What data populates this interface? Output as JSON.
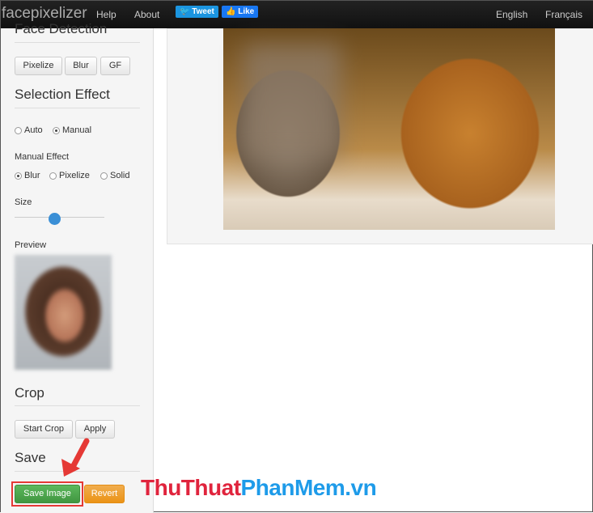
{
  "header": {
    "brand": "facepixelizer",
    "nav": [
      "Help",
      "About"
    ],
    "tweet": "Tweet",
    "like": "Like",
    "lang": [
      "English",
      "Français"
    ]
  },
  "sidebar": {
    "face_detection": {
      "title": "Face Detection",
      "buttons": [
        "Pixelize",
        "Blur",
        "GF"
      ]
    },
    "selection_effect": {
      "title": "Selection Effect",
      "options": [
        "Auto",
        "Manual"
      ],
      "selected": "Manual"
    },
    "manual_effect": {
      "label": "Manual Effect",
      "options": [
        "Blur",
        "Pixelize",
        "Solid"
      ],
      "selected": "Blur"
    },
    "size": {
      "label": "Size",
      "value": 0.45
    },
    "preview": {
      "label": "Preview"
    },
    "crop": {
      "title": "Crop",
      "buttons": [
        "Start Crop",
        "Apply"
      ]
    },
    "save": {
      "title": "Save",
      "save_button": "Save Image",
      "revert_button": "Revert"
    }
  },
  "watermark": {
    "part1": "ThuThuat",
    "part2": "PhanMem",
    "part3": ".vn"
  },
  "colors": {
    "save": "#4cae4c",
    "revert": "#f0ad4e",
    "highlight": "#e53935",
    "wm_red": "#e0243d",
    "wm_blue": "#1e9be9"
  }
}
